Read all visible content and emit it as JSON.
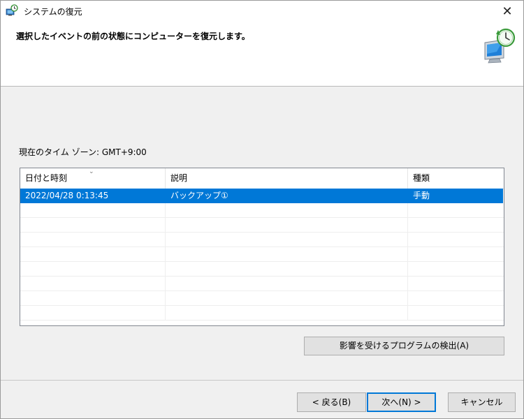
{
  "window": {
    "title": "システムの復元",
    "close_glyph": "✕"
  },
  "header": {
    "instruction": "選択したイベントの前の状態にコンピューターを復元します。",
    "icon": "system-restore-icon"
  },
  "timezone": {
    "label": "現在のタイム ゾーン: GMT+9:00"
  },
  "table": {
    "columns": [
      "日付と時刻",
      "説明",
      "種類"
    ],
    "rows": [
      {
        "date": "2022/04/28 0:13:45",
        "description": "バックアップ①",
        "type": "手動",
        "selected": true
      }
    ]
  },
  "buttons": {
    "scan": "影響を受けるプログラムの検出(A)",
    "back": "< 戻る(B)",
    "next": "次へ(N) >",
    "cancel": "キャンセル"
  },
  "colors": {
    "selection": "#0078d7",
    "dialog_bg": "#f0f0f0"
  }
}
